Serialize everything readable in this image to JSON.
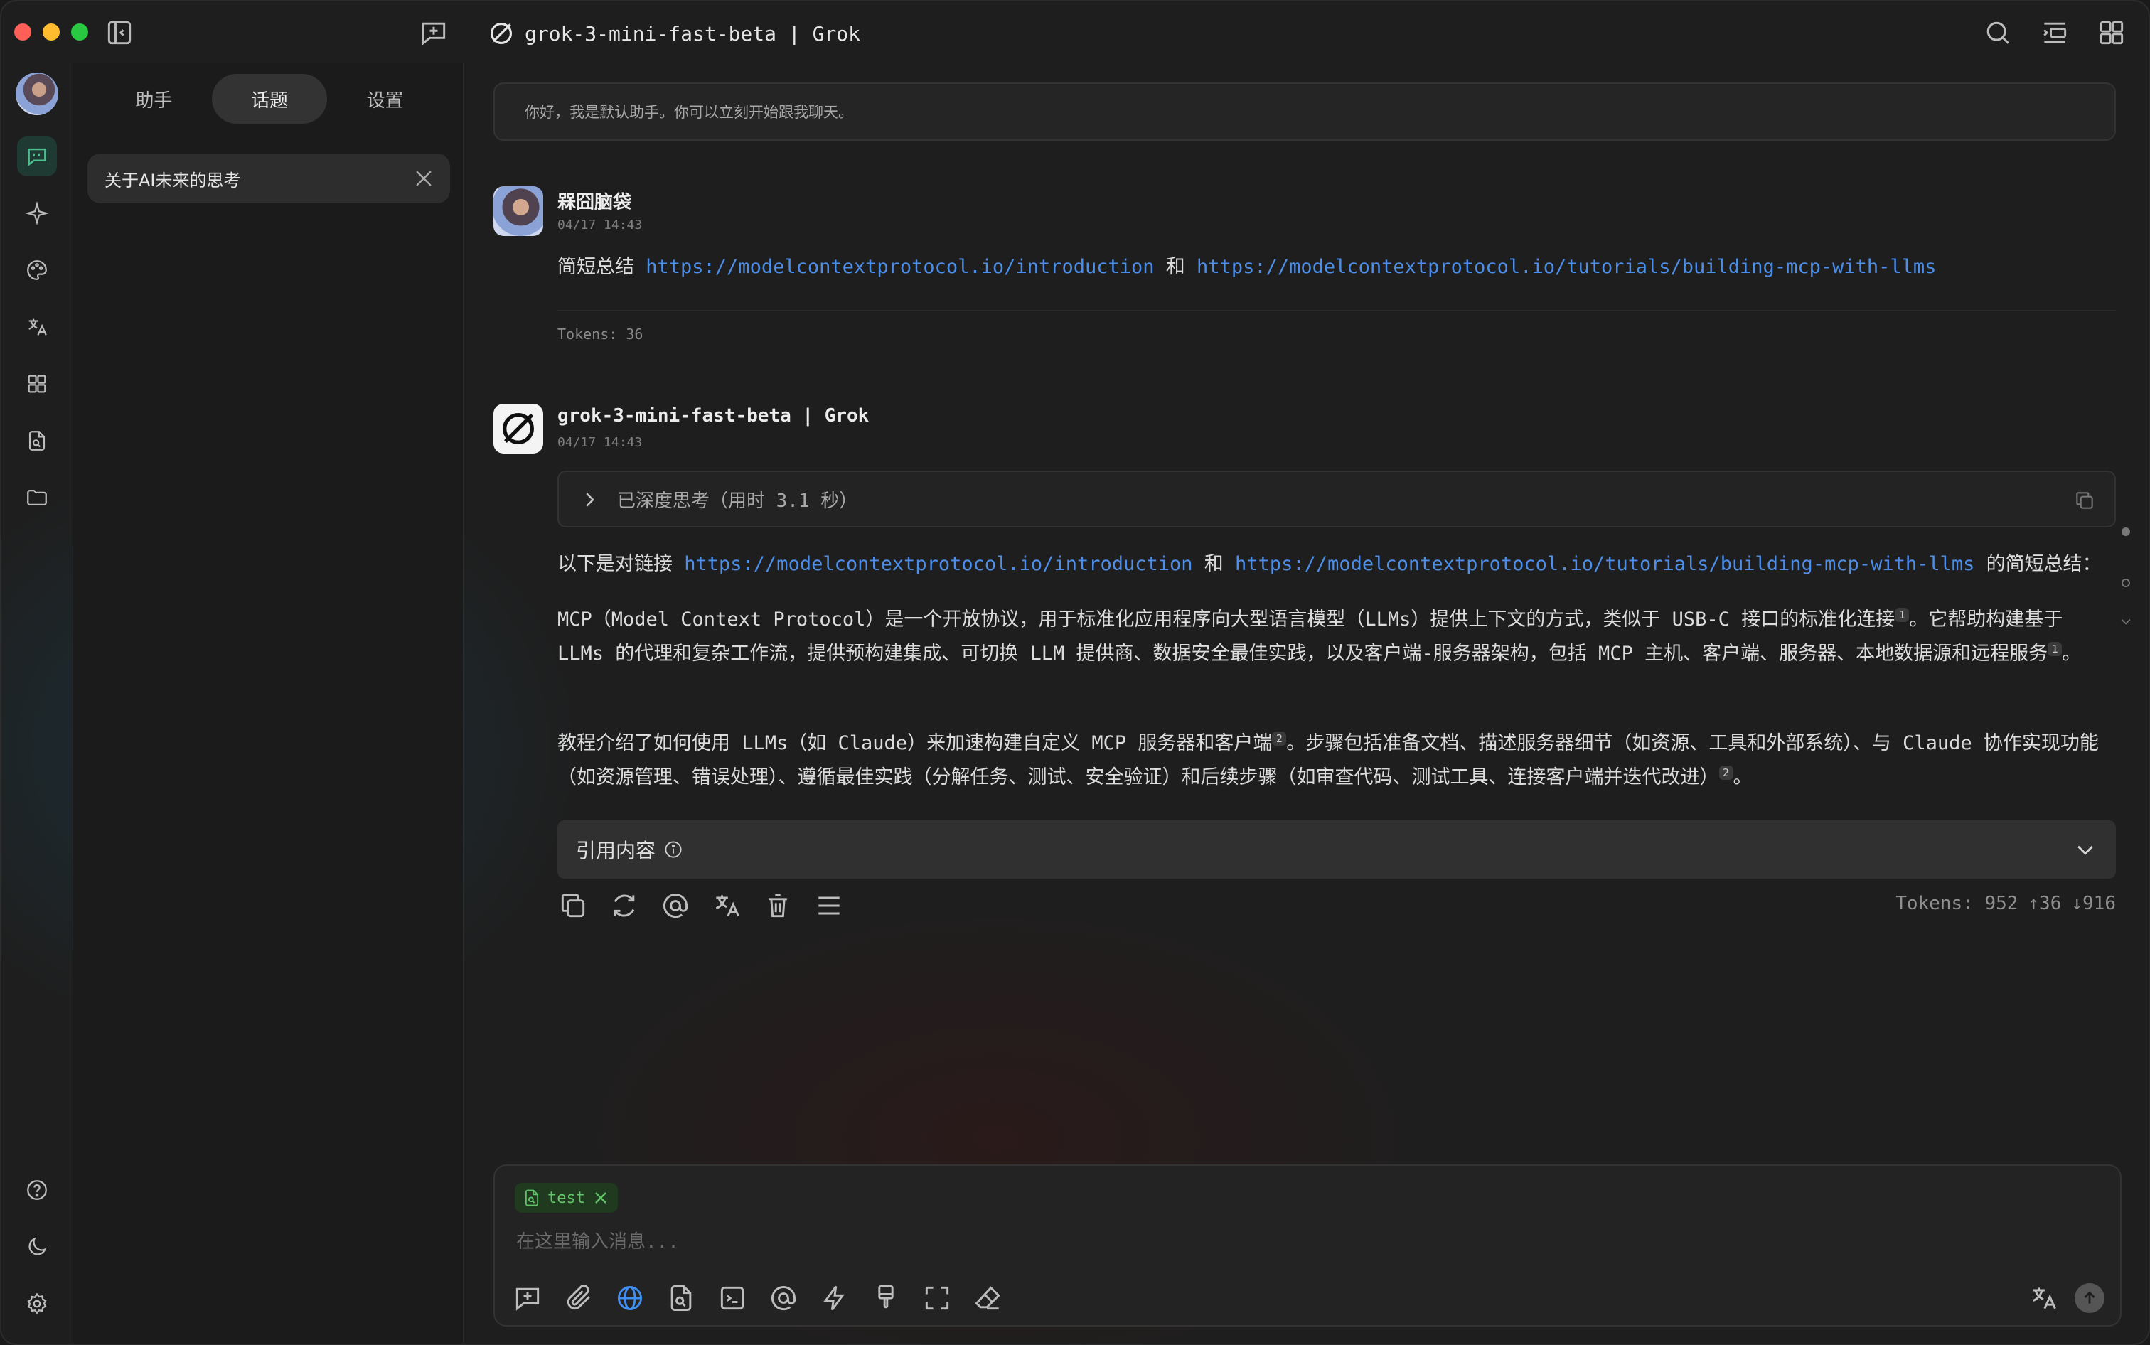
{
  "window": {
    "title": "grok-3-mini-fast-beta | Grok"
  },
  "sidebar": {
    "tabs": [
      {
        "label": "助手",
        "active": false
      },
      {
        "label": "话题",
        "active": true
      },
      {
        "label": "设置",
        "active": false
      }
    ],
    "topic": {
      "label": "关于AI未来的思考"
    }
  },
  "rail": {
    "items": [
      {
        "icon": "chat-icon",
        "active": true
      },
      {
        "icon": "sparkle-icon"
      },
      {
        "icon": "palette-icon"
      },
      {
        "icon": "translate-icon"
      },
      {
        "icon": "apps-grid-icon"
      },
      {
        "icon": "file-search-icon"
      },
      {
        "icon": "folder-icon"
      }
    ],
    "bottom": [
      {
        "icon": "help-icon"
      },
      {
        "icon": "moon-icon"
      },
      {
        "icon": "gear-icon"
      }
    ]
  },
  "chat": {
    "system_message": "你好，我是默认助手。你可以立刻开始跟我聊天。",
    "user": {
      "name": "槑囧脑袋",
      "time": "04/17 14:43",
      "text_prefix": "简短总结",
      "link1": "https://modelcontextprotocol.io/introduction",
      "joiner": "和",
      "link2": "https://modelcontextprotocol.io/tutorials/building-mcp-with-llms",
      "tokens": "Tokens: 36"
    },
    "assistant": {
      "name": "grok-3-mini-fast-beta | Grok",
      "time": "04/17 14:43",
      "thinking": "已深度思考（用时 3.1 秒）",
      "intro_prefix": "以下是对链接",
      "intro_link1": "https://modelcontextprotocol.io/introduction",
      "intro_joiner": "和",
      "intro_link2": "https://modelcontextprotocol.io/tutorials/building-mcp-with-llms",
      "intro_suffix": "的简短总结：",
      "p1_a": "MCP（Model Context Protocol）是一个开放协议，用于标准化应用程序向大型语言模型（LLMs）提供上下文的方式，类似于 USB-C 接口的标准化连接",
      "p1_cite1": "1",
      "p1_b": "。它帮助构建基于 LLMs 的代理和复杂工作流，提供预构建集成、可切换 LLM 提供商、数据安全最佳实践，以及客户端-服务器架构，包括 MCP 主机、客户端、服务器、本地数据源和远程服务",
      "p1_cite2": "1",
      "p1_c": "。",
      "p2_a": "教程介绍了如何使用 LLMs（如 Claude）来加速构建自定义 MCP 服务器和客户端",
      "p2_cite1": "2",
      "p2_b": "。步骤包括准备文档、描述服务器细节（如资源、工具和外部系统）、与 Claude 协作实现功能（如资源管理、错误处理）、遵循最佳实践（分解任务、测试、安全验证）和后续步骤（如审查代码、测试工具、连接客户端并迭代改进）",
      "p2_cite2": "2",
      "p2_c": "。",
      "citation_label": "引用内容",
      "tokens_label": "Tokens: 952",
      "tokens_up": "↑36",
      "tokens_down": "↓916"
    }
  },
  "input": {
    "attachment": "test",
    "placeholder": "在这里输入消息..."
  }
}
